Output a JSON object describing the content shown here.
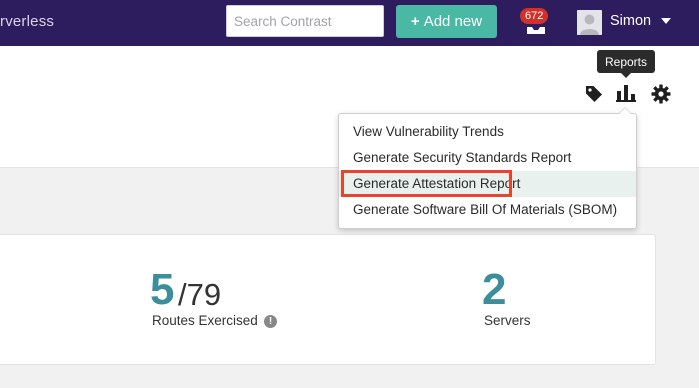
{
  "header": {
    "brand_text": "rverless",
    "search_placeholder": "Search Contrast",
    "add_button_label": "Add new",
    "notification_count": "672",
    "user_name": "Simon"
  },
  "toolbar": {
    "tooltip_label": "Reports",
    "icons": [
      "tag-icon",
      "bar-chart-icon",
      "gear-icon"
    ]
  },
  "reports_menu": {
    "items": [
      {
        "label": "View Vulnerability Trends"
      },
      {
        "label": "Generate Security Standards Report"
      },
      {
        "label": "Generate Attestation Report"
      },
      {
        "label": "Generate Software Bill Of Materials (SBOM)"
      }
    ],
    "highlighted_index": 2
  },
  "stats": {
    "routes": {
      "exercised": "5",
      "total": "/79",
      "label": "Routes Exercised"
    },
    "servers": {
      "count": "2",
      "label": "Servers"
    }
  },
  "colors": {
    "topbar": "#2d1d5e",
    "accent_teal": "#49b8a4",
    "stat_teal": "#3c8f9a",
    "badge_red": "#d1312a",
    "highlight_red": "#e8442a"
  }
}
